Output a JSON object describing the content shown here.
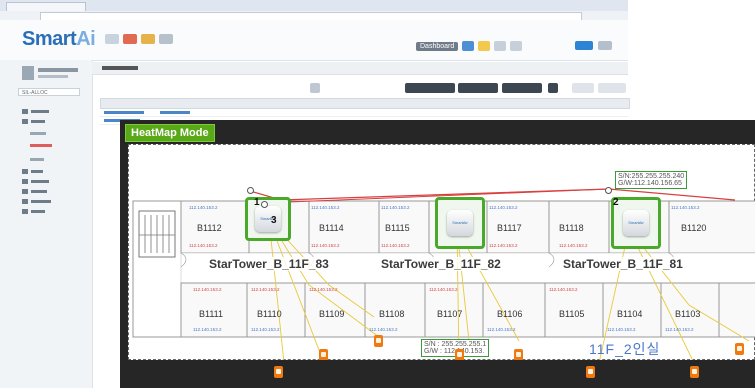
{
  "heatmap": {
    "title": "HeatMap Mode",
    "access_points": [
      {
        "label": "StarTower_B_11F_83",
        "number": "1",
        "device_brand": "SmartAir"
      },
      {
        "label": "StarTower_B_11F_82",
        "number": "",
        "device_brand": "SmartAir"
      },
      {
        "label": "StarTower_B_11F_81",
        "number": "2",
        "device_brand": "SmartAir"
      }
    ],
    "marker_3": "3",
    "rooms_top": [
      "B1112",
      "B1114",
      "B1115",
      "B1117",
      "B1118",
      "B1120"
    ],
    "rooms_bottom": [
      "B1111",
      "B1110",
      "B1109",
      "B1108",
      "B1107",
      "B1106",
      "B1105",
      "B1104",
      "B1103"
    ],
    "info_top": {
      "sn": "S/N:255.255.255.240",
      "gw": "G/W:112.140.156.65"
    },
    "info_bottom": {
      "sn": "S/N : 255.255.255.1",
      "gw": "G/W : 112.140.153."
    },
    "floor_label": "11F_2인실",
    "ip_top": "112.140.153.2",
    "ip_bottom": "112.140.153.2"
  },
  "app": {
    "logo_prefix": "Smart",
    "logo_suffix": "Ai",
    "dashboard_label": "Dashboard",
    "sidebar_select": "SIL-ALLOC",
    "colors": {
      "heatmap_badge": "#58a817",
      "ap_border": "#4aa82a",
      "room_text_blue": "#4b78c6",
      "device_orange": "#f07a12"
    }
  }
}
